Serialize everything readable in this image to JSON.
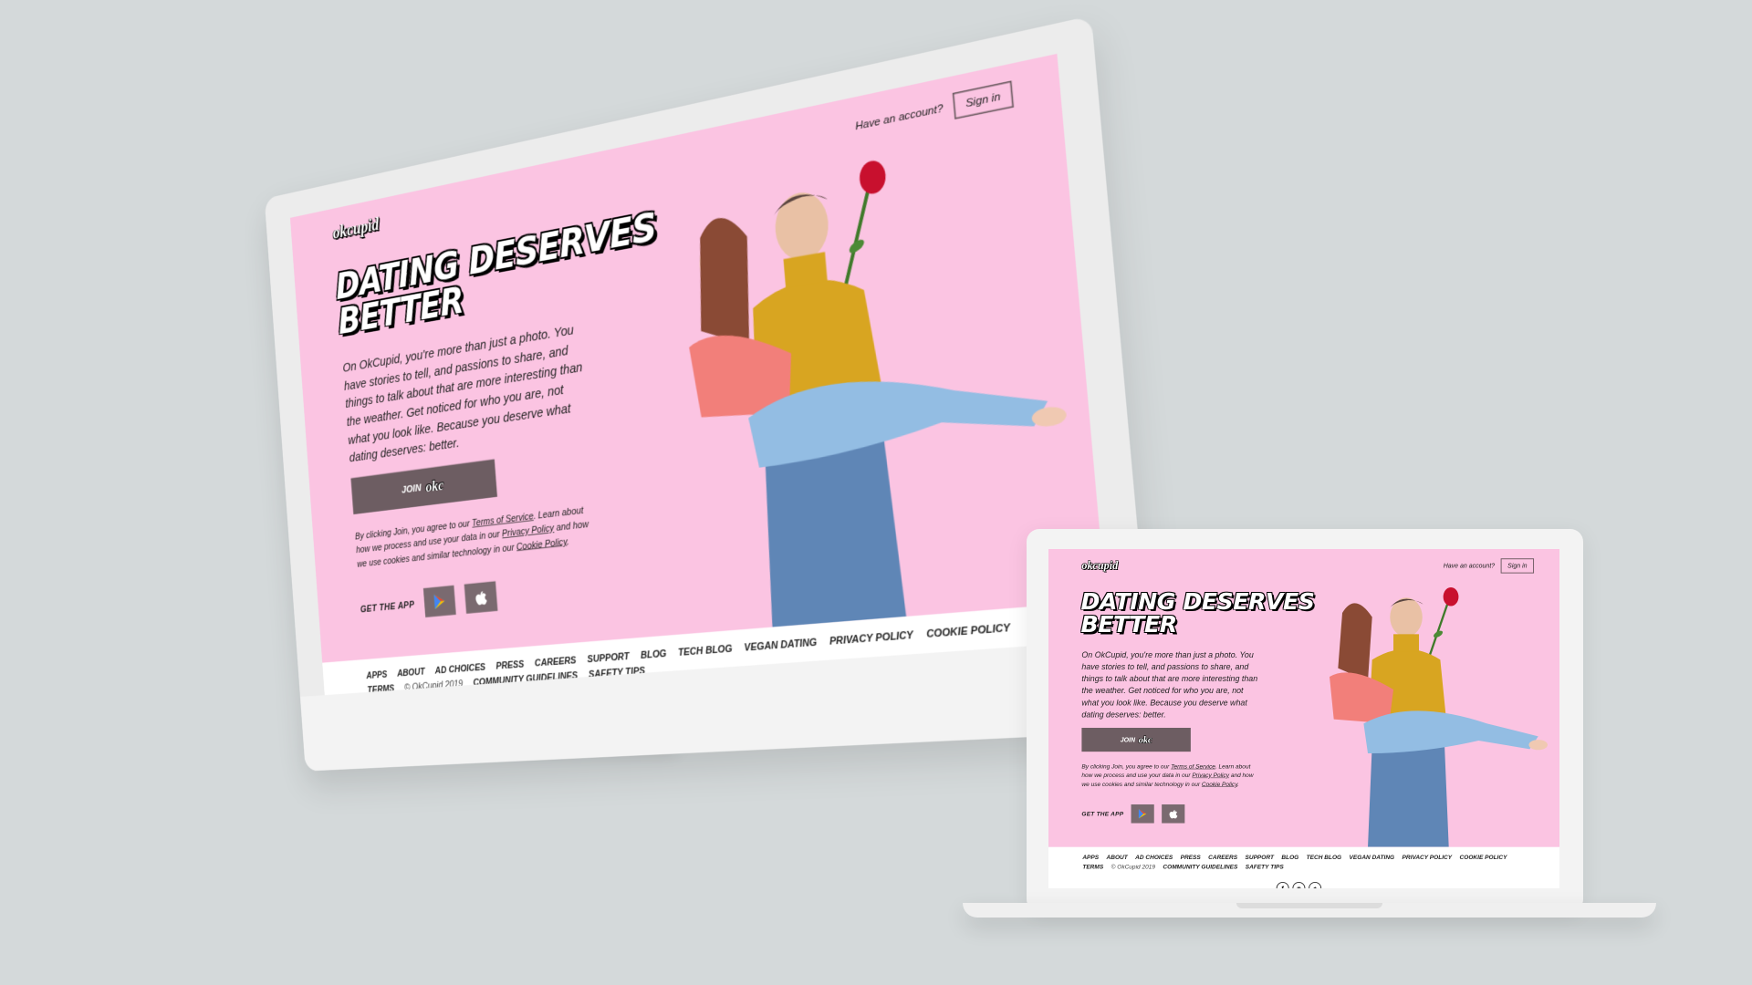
{
  "okc": {
    "logo": "okcupid",
    "have_account": "Have an account?",
    "signin_label": "Sign in",
    "headline": "DATING DESERVES BETTER",
    "description": "On OkCupid, you're more than just a photo. You have stories to tell, and passions to share, and things to talk about that are more interesting than the weather. Get noticed for who you are, not what you look like. Because you deserve what dating deserves: better.",
    "join_label": "JOIN",
    "join_badge": "okc",
    "legal_prefix": "By clicking Join, you agree to our ",
    "legal_terms": "Terms of Service",
    "legal_mid": ". Learn about how we process and use your data in our ",
    "legal_privacy": "Privacy Policy",
    "legal_mid2": " and how we use cookies and similar technology in our ",
    "legal_cookie": "Cookie Policy",
    "legal_end": ".",
    "get_app": "GET THE APP",
    "footer_links": [
      "APPS",
      "ABOUT",
      "AD CHOICES",
      "PRESS",
      "CAREERS",
      "SUPPORT",
      "BLOG",
      "TECH BLOG",
      "VEGAN DATING",
      "PRIVACY POLICY",
      "COOKIE POLICY",
      "TERMS"
    ],
    "footer_links2": [
      "COMMUNITY GUIDELINES",
      "SAFETY TIPS"
    ],
    "copyright": "© OkCupid 2019",
    "social_icons": [
      "facebook-icon",
      "instagram-icon",
      "twitter-icon"
    ]
  },
  "colors": {
    "background": "#d4d9da",
    "page_pink": "#fbc4e2",
    "button": "#6d5d62"
  }
}
